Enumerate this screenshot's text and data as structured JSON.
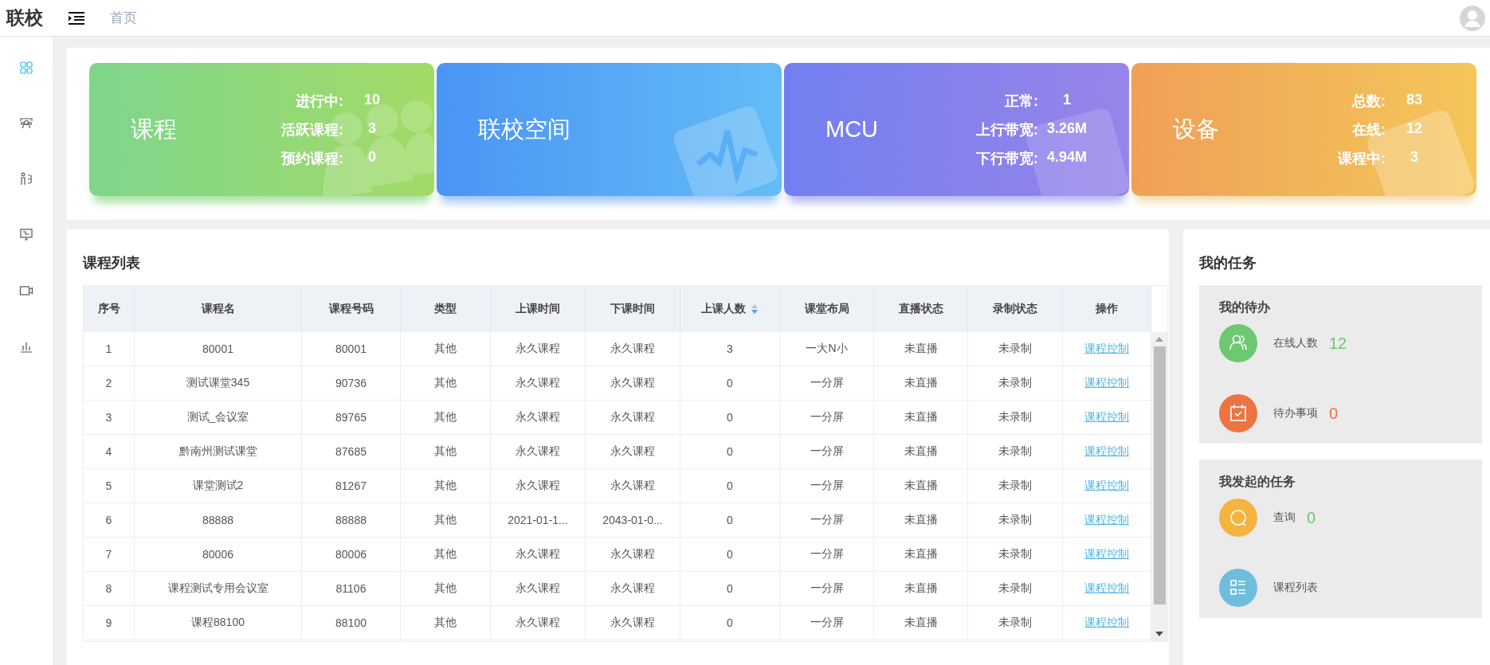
{
  "header": {
    "logo": "联校",
    "breadcrumb": "首页"
  },
  "sidebar": {
    "items": [
      {
        "kind": "dashboard",
        "selected": true
      },
      {
        "kind": "group",
        "selected": false
      },
      {
        "kind": "presenter",
        "selected": false
      },
      {
        "kind": "monitor",
        "selected": false
      },
      {
        "kind": "camera",
        "selected": false
      },
      {
        "kind": "chart",
        "selected": false
      }
    ]
  },
  "cards": [
    {
      "kind": "courses",
      "title": "课程",
      "stats": [
        {
          "label": "进行中:",
          "value": "10"
        },
        {
          "label": "活跃课程:",
          "value": "3"
        },
        {
          "label": "预约课程:",
          "value": "0"
        }
      ]
    },
    {
      "kind": "space",
      "title": "联校空间"
    },
    {
      "kind": "mcu",
      "title": "MCU",
      "stats": [
        {
          "label": "正常:",
          "value": "1"
        },
        {
          "label": "上行带宽:",
          "value": "3.26M"
        },
        {
          "label": "下行带宽:",
          "value": "4.94M"
        }
      ]
    },
    {
      "kind": "devices",
      "title": "设备",
      "stats": [
        {
          "label": "总数:",
          "value": "83"
        },
        {
          "label": "在线:",
          "value": "12"
        },
        {
          "label": "课程中:",
          "value": "3"
        }
      ]
    }
  ],
  "course_list": {
    "title": "课程列表",
    "columns": [
      {
        "label": "序号",
        "sortable": false
      },
      {
        "label": "课程名",
        "sortable": false
      },
      {
        "label": "课程号码",
        "sortable": false
      },
      {
        "label": "类型",
        "sortable": false
      },
      {
        "label": "上课时间",
        "sortable": false
      },
      {
        "label": "下课时间",
        "sortable": false
      },
      {
        "label": "上课人数",
        "sortable": true
      },
      {
        "label": "课堂布局",
        "sortable": false
      },
      {
        "label": "直播状态",
        "sortable": false
      },
      {
        "label": "录制状态",
        "sortable": false
      },
      {
        "label": "操作",
        "sortable": false
      }
    ],
    "rows": [
      [
        "1",
        "80001",
        "80001",
        "其他",
        "永久课程",
        "永久课程",
        "3",
        "一大N小",
        "未直播",
        "未录制",
        "课程控制"
      ],
      [
        "2",
        "测试课堂345",
        "90736",
        "其他",
        "永久课程",
        "永久课程",
        "0",
        "一分屏",
        "未直播",
        "未录制",
        "课程控制"
      ],
      [
        "3",
        "测试_会议室",
        "89765",
        "其他",
        "永久课程",
        "永久课程",
        "0",
        "一分屏",
        "未直播",
        "未录制",
        "课程控制"
      ],
      [
        "4",
        "黔南州测试课堂",
        "87685",
        "其他",
        "永久课程",
        "永久课程",
        "0",
        "一分屏",
        "未直播",
        "未录制",
        "课程控制"
      ],
      [
        "5",
        "课堂测试2",
        "81267",
        "其他",
        "永久课程",
        "永久课程",
        "0",
        "一分屏",
        "未直播",
        "未录制",
        "课程控制"
      ],
      [
        "6",
        "88888",
        "88888",
        "其他",
        "2021-01-1...",
        "2043-01-0...",
        "0",
        "一分屏",
        "未直播",
        "未录制",
        "课程控制"
      ],
      [
        "7",
        "80006",
        "80006",
        "其他",
        "永久课程",
        "永久课程",
        "0",
        "一分屏",
        "未直播",
        "未录制",
        "课程控制"
      ],
      [
        "8",
        "课程测试专用会议室",
        "81106",
        "其他",
        "永久课程",
        "永久课程",
        "0",
        "一分屏",
        "未直播",
        "未录制",
        "课程控制"
      ],
      [
        "9",
        "课程88100",
        "88100",
        "其他",
        "永久课程",
        "永久课程",
        "0",
        "一分屏",
        "未直播",
        "未录制",
        "课程控制"
      ]
    ]
  },
  "tasks": {
    "title": "我的任务",
    "groups": [
      {
        "title": "我的待办",
        "items": [
          {
            "kind": "people",
            "label": "在线人数",
            "value": "12",
            "color": "#6cc86f"
          },
          {
            "kind": "calendar",
            "label": "待办事项",
            "value": "0",
            "color": "#ef7240"
          }
        ]
      },
      {
        "title": "我发起的任务",
        "items": [
          {
            "kind": "search",
            "label": "查询",
            "value": "0",
            "color": "#6cc86f"
          },
          {
            "kind": "list",
            "label": "课程列表"
          }
        ]
      }
    ]
  }
}
